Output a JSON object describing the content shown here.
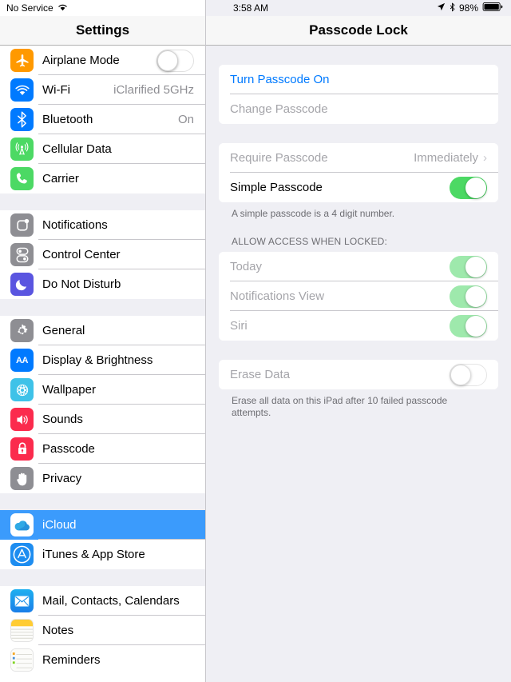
{
  "left_panel": {
    "status": {
      "carrier": "No Service",
      "wifi_icon": "wifi-icon"
    },
    "nav_title": "Settings",
    "sections": [
      {
        "items": [
          {
            "label": "Airplane Mode",
            "icon": "airplane-icon",
            "control": "switch-off"
          },
          {
            "label": "Wi-Fi",
            "icon": "wifi-icon",
            "value": "iClarified 5GHz"
          },
          {
            "label": "Bluetooth",
            "icon": "bluetooth-icon",
            "value": "On"
          },
          {
            "label": "Cellular Data",
            "icon": "cellular-icon"
          },
          {
            "label": "Carrier",
            "icon": "phone-icon"
          }
        ]
      },
      {
        "items": [
          {
            "label": "Notifications",
            "icon": "notifications-icon"
          },
          {
            "label": "Control Center",
            "icon": "control-center-icon"
          },
          {
            "label": "Do Not Disturb",
            "icon": "moon-icon"
          }
        ]
      },
      {
        "items": [
          {
            "label": "General",
            "icon": "gear-icon"
          },
          {
            "label": "Display & Brightness",
            "icon": "display-brightness-icon"
          },
          {
            "label": "Wallpaper",
            "icon": "wallpaper-icon"
          },
          {
            "label": "Sounds",
            "icon": "speaker-icon"
          },
          {
            "label": "Passcode",
            "icon": "lock-icon"
          },
          {
            "label": "Privacy",
            "icon": "hand-icon"
          }
        ]
      },
      {
        "items": [
          {
            "label": "iCloud",
            "icon": "icloud-icon",
            "selected": true
          },
          {
            "label": "iTunes & App Store",
            "icon": "app-store-icon"
          }
        ]
      },
      {
        "items": [
          {
            "label": "Mail, Contacts, Calendars",
            "icon": "mail-icon"
          },
          {
            "label": "Notes",
            "icon": "notes-icon"
          },
          {
            "label": "Reminders",
            "icon": "reminders-icon"
          }
        ]
      }
    ]
  },
  "right_panel": {
    "status": {
      "time": "3:58 AM",
      "location_icon": "location-arrow-icon",
      "bluetooth_icon": "bluetooth-icon",
      "battery_percent": "98%",
      "battery_icon": "battery-icon"
    },
    "nav_title": "Passcode Lock",
    "group1": {
      "turn_passcode_on": "Turn Passcode On",
      "change_passcode": "Change Passcode"
    },
    "group2": {
      "require_passcode_label": "Require Passcode",
      "require_passcode_value": "Immediately",
      "simple_passcode_label": "Simple Passcode",
      "footnote": "A simple passcode is a 4 digit number."
    },
    "group3": {
      "header": "ALLOW ACCESS WHEN LOCKED:",
      "items": [
        {
          "label": "Today",
          "state": "on-faded"
        },
        {
          "label": "Notifications View",
          "state": "on-faded"
        },
        {
          "label": "Siri",
          "state": "on-faded"
        }
      ]
    },
    "group4": {
      "erase_data_label": "Erase Data",
      "footnote": "Erase all data on this iPad after 10 failed passcode attempts."
    }
  },
  "colors": {
    "accent_blue": "#007aff",
    "selection_blue": "#3b9bfc",
    "switch_green": "#4cd964",
    "panel_gray": "#efeff4"
  }
}
